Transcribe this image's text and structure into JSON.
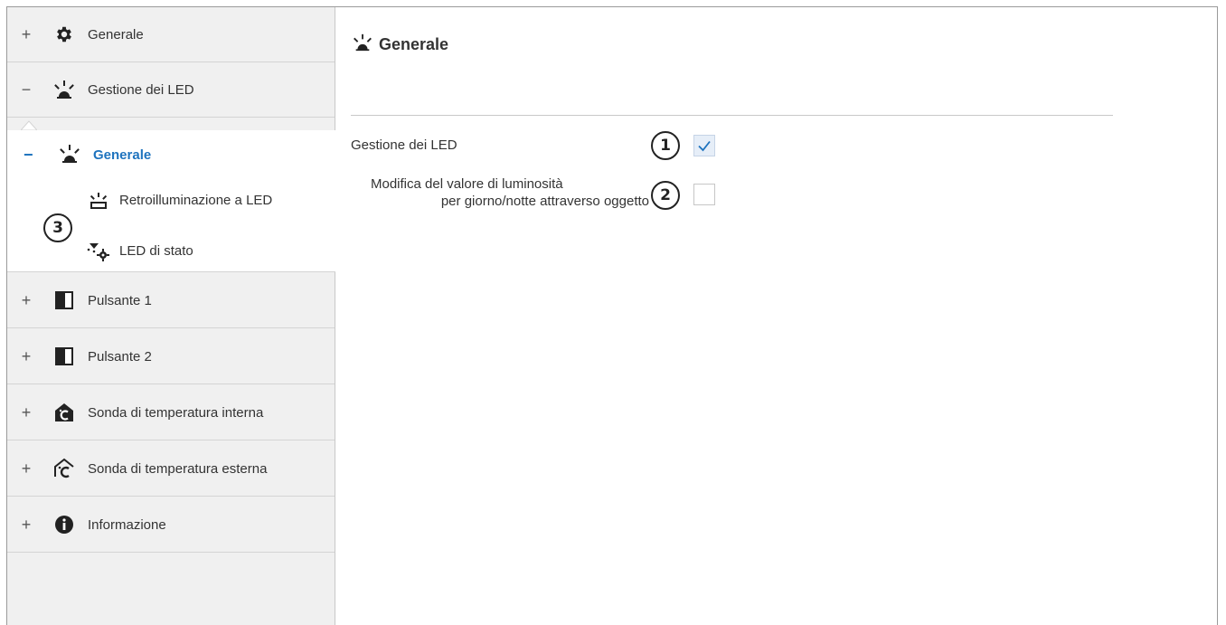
{
  "sidebar": {
    "items": [
      {
        "toggle": "+",
        "label": "Generale",
        "icon": "gear-icon"
      },
      {
        "toggle": "−",
        "label": "Gestione dei LED",
        "icon": "led-light-icon"
      },
      {
        "toggle": "+",
        "label": "Pulsante 1",
        "icon": "pushbutton-icon"
      },
      {
        "toggle": "+",
        "label": "Pulsante 2",
        "icon": "pushbutton-icon"
      },
      {
        "toggle": "+",
        "label": "Sonda di temperatura interna",
        "icon": "indoor-temperature-icon"
      },
      {
        "toggle": "+",
        "label": "Sonda di temperatura esterna",
        "icon": "outdoor-temperature-icon"
      },
      {
        "toggle": "+",
        "label": "Informazione",
        "icon": "info-icon"
      }
    ],
    "active": {
      "toggle": "−",
      "label": "Generale",
      "icon": "led-light-icon"
    },
    "leaves": [
      {
        "label": "Retroilluminazione a LED",
        "icon": "backlight-icon"
      },
      {
        "label": "LED di stato",
        "icon": "status-led-icon"
      }
    ]
  },
  "content": {
    "title": "Generale",
    "params": [
      {
        "label": "Gestione dei LED",
        "checked": true
      },
      {
        "label_line1": "Modifica del valore di luminosità",
        "label_line2": "per giorno/notte attraverso oggetto",
        "checked": false
      }
    ]
  },
  "callouts": [
    "1",
    "2",
    "3"
  ],
  "colors": {
    "accent": "#1e73be",
    "sidebar_bg": "#f0f0f0",
    "checked_bg": "#e6eef8"
  }
}
